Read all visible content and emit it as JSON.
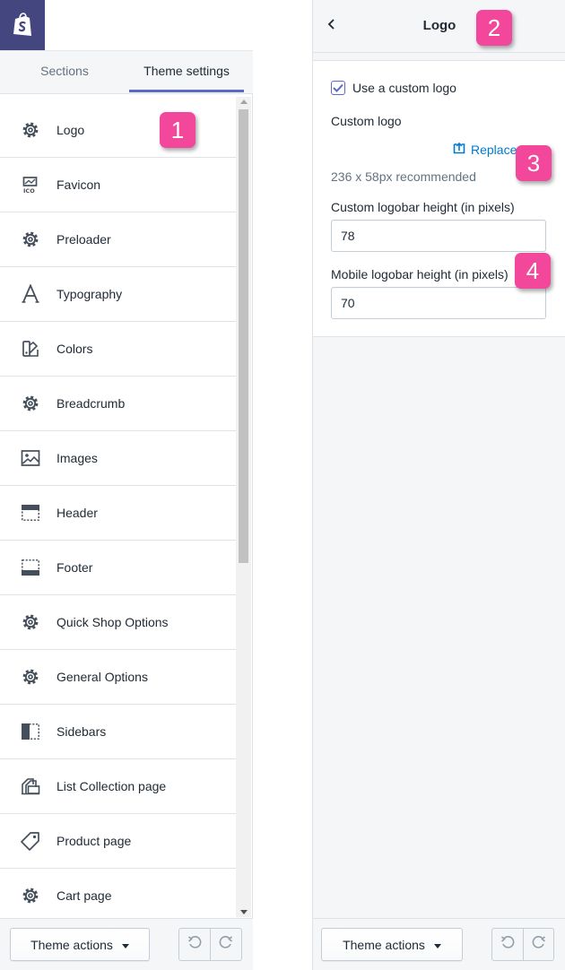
{
  "left_panel": {
    "tabs": {
      "sections": "Sections",
      "theme_settings": "Theme settings"
    },
    "items": [
      {
        "label": "Logo",
        "icon": "gear-icon"
      },
      {
        "label": "Favicon",
        "icon": "favicon-icon"
      },
      {
        "label": "Preloader",
        "icon": "gear-icon"
      },
      {
        "label": "Typography",
        "icon": "typography-icon"
      },
      {
        "label": "Colors",
        "icon": "colors-icon"
      },
      {
        "label": "Breadcrumb",
        "icon": "gear-icon"
      },
      {
        "label": "Images",
        "icon": "image-icon"
      },
      {
        "label": "Header",
        "icon": "header-icon"
      },
      {
        "label": "Footer",
        "icon": "footer-icon"
      },
      {
        "label": "Quick Shop Options",
        "icon": "gear-icon"
      },
      {
        "label": "General Options",
        "icon": "gear-icon"
      },
      {
        "label": "Sidebars",
        "icon": "sidebar-icon"
      },
      {
        "label": "List Collection page",
        "icon": "collection-icon"
      },
      {
        "label": "Product page",
        "icon": "tag-icon"
      },
      {
        "label": "Cart page",
        "icon": "gear-icon"
      }
    ],
    "footer": {
      "theme_actions": "Theme actions"
    }
  },
  "right_panel": {
    "title": "Logo",
    "use_custom_logo_label": "Use a custom logo",
    "use_custom_logo_checked": true,
    "custom_logo_label": "Custom logo",
    "replace_label": "Replace",
    "recommended_hint": "236 x 58px recommended",
    "logobar_height_label": "Custom logobar height (in pixels)",
    "logobar_height_value": "78",
    "mobile_logobar_height_label": "Mobile logobar height (in pixels)",
    "mobile_logobar_height_value": "70",
    "footer": {
      "theme_actions": "Theme actions"
    }
  },
  "badges": [
    "1",
    "2",
    "3",
    "4"
  ],
  "colors": {
    "shopify_header": "#43467f",
    "tab_underline": "#5c6ac4",
    "link_blue": "#007ace",
    "badge_pink": "#f2479b"
  }
}
